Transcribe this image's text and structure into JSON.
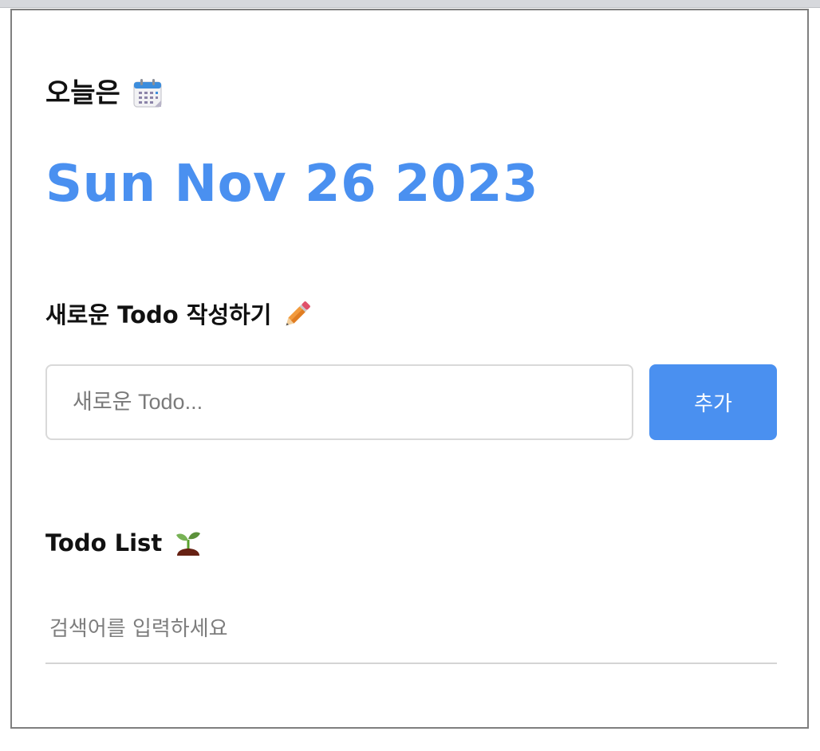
{
  "header": {
    "today_label": "오늘은",
    "today_icon": "calendar-icon",
    "date": "Sun Nov 26 2023"
  },
  "editor": {
    "title": "새로운 Todo 작성하기",
    "title_icon": "pencil-icon",
    "input_placeholder": "새로운 Todo...",
    "input_value": "",
    "add_label": "추가"
  },
  "list": {
    "title": "Todo List",
    "title_icon": "seedling-icon",
    "search_placeholder": "검색어를 입력하세요",
    "search_value": ""
  },
  "colors": {
    "accent": "#4a90f0",
    "heading": "#111111",
    "border": "#d9d9d9"
  }
}
